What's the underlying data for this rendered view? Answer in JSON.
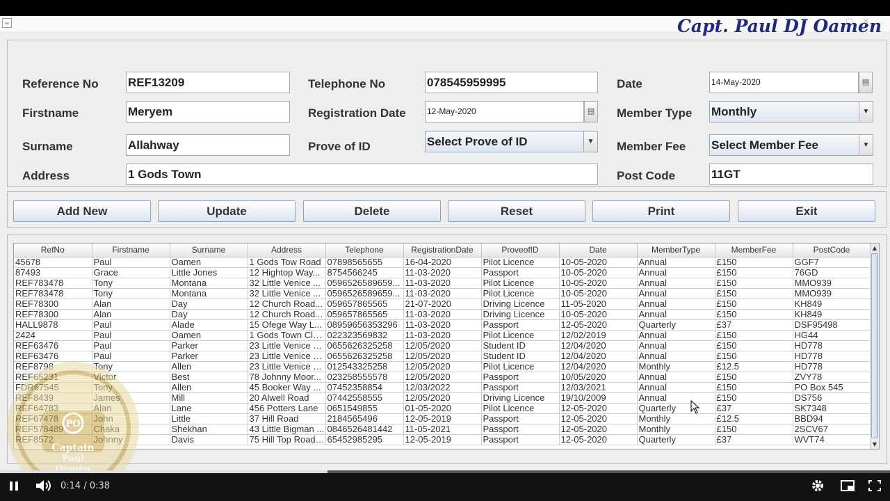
{
  "header": {
    "brand_title": "Capt. Paul DJ Oamen"
  },
  "form": {
    "reference_no": {
      "label": "Reference No",
      "value": "REF13209"
    },
    "firstname": {
      "label": "Firstname",
      "value": "Meryem"
    },
    "surname": {
      "label": "Surname",
      "value": "Allahway"
    },
    "address": {
      "label": "Address",
      "value": "1 Gods Town"
    },
    "telephone_no": {
      "label": "Telephone No",
      "value": "078545959995"
    },
    "registration_date": {
      "label": "Registration Date",
      "value": "12-May-2020"
    },
    "prove_of_id": {
      "label": "Prove of ID",
      "value": "Select Prove of ID"
    },
    "date": {
      "label": "Date",
      "value": "14-May-2020"
    },
    "member_type": {
      "label": "Member Type",
      "value": "Monthly"
    },
    "member_fee": {
      "label": "Member Fee",
      "value": "Select Member Fee"
    },
    "post_code": {
      "label": "Post Code",
      "value": "11GT"
    }
  },
  "buttons": {
    "add_new": "Add New",
    "update": "Update",
    "delete": "Delete",
    "reset": "Reset",
    "print": "Print",
    "exit": "Exit"
  },
  "table": {
    "columns": [
      "RefNo",
      "Firstname",
      "Surname",
      "Address",
      "Telephone",
      "RegistrationDate",
      "ProveofID",
      "Date",
      "MemberType",
      "MemberFee",
      "PostCode"
    ],
    "rows": [
      [
        "45678",
        "Paul",
        "Oamen",
        "1 Gods Tow Road",
        "07898565655",
        "16-04-2020",
        "Pilot Licence",
        "10-05-2020",
        "Annual",
        "£150",
        "GGF7"
      ],
      [
        "87493",
        "Grace",
        "Little Jones",
        "12 Hightop Way...",
        "8754566245",
        "11-03-2020",
        "Passport",
        "10-05-2020",
        "Annual",
        "£150",
        "76GD"
      ],
      [
        "REF783478",
        "Tony",
        "Montana",
        "32 Little Venice ...",
        "0596526589659...",
        "11-03-2020",
        "Pilot Licence",
        "10-05-2020",
        "Annual",
        "£150",
        "MMO939"
      ],
      [
        "REF783478",
        "Tony",
        "Montana",
        "32 Little Venice ...",
        "0596526589659...",
        "11-03-2020",
        "Pilot Licence",
        "10-05-2020",
        "Annual",
        "£150",
        "MMO939"
      ],
      [
        "REF78300",
        "Alan",
        "Day",
        "12 Church Road...",
        "059657865565",
        "21-07-2020",
        "Driving Licence",
        "11-05-2020",
        "Annual",
        "£150",
        "KH849"
      ],
      [
        "REF78300",
        "Alan",
        "Day",
        "12 Church Road...",
        "059657865565",
        "11-03-2020",
        "Driving Licence",
        "10-05-2020",
        "Annual",
        "£150",
        "KH849"
      ],
      [
        "HALL9878",
        "Paul",
        "Alade",
        "15 Ofege Way L...",
        "08959656353296",
        "11-03-2020",
        "Passport",
        "12-05-2020",
        "Quarterly",
        "£37",
        "DSF95498"
      ],
      [
        "2424",
        "Paul",
        "Oamen",
        "1 Gods Town Clo...",
        "022323569832",
        "11-03-2020",
        "Pilot Licence",
        "12/02/2019",
        "Annual",
        "£150",
        "HG44"
      ],
      [
        "REF63476",
        "Paul",
        "Parker",
        "23 Little Venice L...",
        "0655626325258",
        "12/05/2020",
        "Student ID",
        "12/04/2020",
        "Annual",
        "£150",
        "HD778"
      ],
      [
        "REF63476",
        "Paul",
        "Parker",
        "23 Little Venice L...",
        "0655626325258",
        "12/05/2020",
        "Student ID",
        "12/04/2020",
        "Annual",
        "£150",
        "HD778"
      ],
      [
        "REF8798",
        "Tony",
        "Allen",
        "23 Little Venice L...",
        "012543325258",
        "12/05/2020",
        "Pilot Licence",
        "12/04/2020",
        "Monthly",
        "£12.5",
        "HD778"
      ],
      [
        "REF65231",
        "Victor",
        "Best",
        "78 Johnny Moor...",
        "023258555578",
        "12/05/2020",
        "Passport",
        "10/05/2020",
        "Annual",
        "£150",
        "ZVY78"
      ],
      [
        "FDR67545",
        "Tony",
        "Allen",
        "45 Booker Way ...",
        "07452358854",
        "12/03/2022",
        "Passport",
        "12/03/2021",
        "Annual",
        "£150",
        "PO Box 545"
      ],
      [
        "REF8439",
        "James",
        "Mill",
        "20 Alwell Road",
        "07442558555",
        "12/05/2020",
        "Driving Licence",
        "19/10/2009",
        "Annual",
        "£150",
        "DS756"
      ],
      [
        "REF64783",
        "Alan",
        "Lane",
        "456 Potters Lane",
        "0651549855",
        "01-05-2020",
        "Pilot Licence",
        "12-05-2020",
        "Quarterly",
        "£37",
        "SK7348"
      ],
      [
        "REF67478",
        "John",
        "Little",
        "37 Hill Road",
        "2184565496",
        "12-05-2019",
        "Passport",
        "12-05-2020",
        "Monthly",
        "£12.5",
        "BBD94"
      ],
      [
        "REF578489",
        "Chaka",
        "Shekhan",
        "43 Little Bigman ...",
        "0846526481442",
        "11-05-2021",
        "Passport",
        "12-05-2020",
        "Monthly",
        "£150",
        "2SCV67"
      ],
      [
        "REF8572",
        "Johnny",
        "Davis",
        "75 Hill Top Road ...",
        "65452985295",
        "12-05-2019",
        "Passport",
        "12-05-2020",
        "Quarterly",
        "£37",
        "WVT74"
      ]
    ]
  },
  "logo": {
    "text_top": "Captain",
    "text_mid": "Paul",
    "text_bottom": "Oamen",
    "text_badge": "PO"
  },
  "video": {
    "time": "0:14 / 0:38",
    "progress": 0.368,
    "buffered": 0.355
  },
  "colors": {
    "brand": "#1f2a80",
    "button_gradient_bottom": "#dbe4ef"
  }
}
